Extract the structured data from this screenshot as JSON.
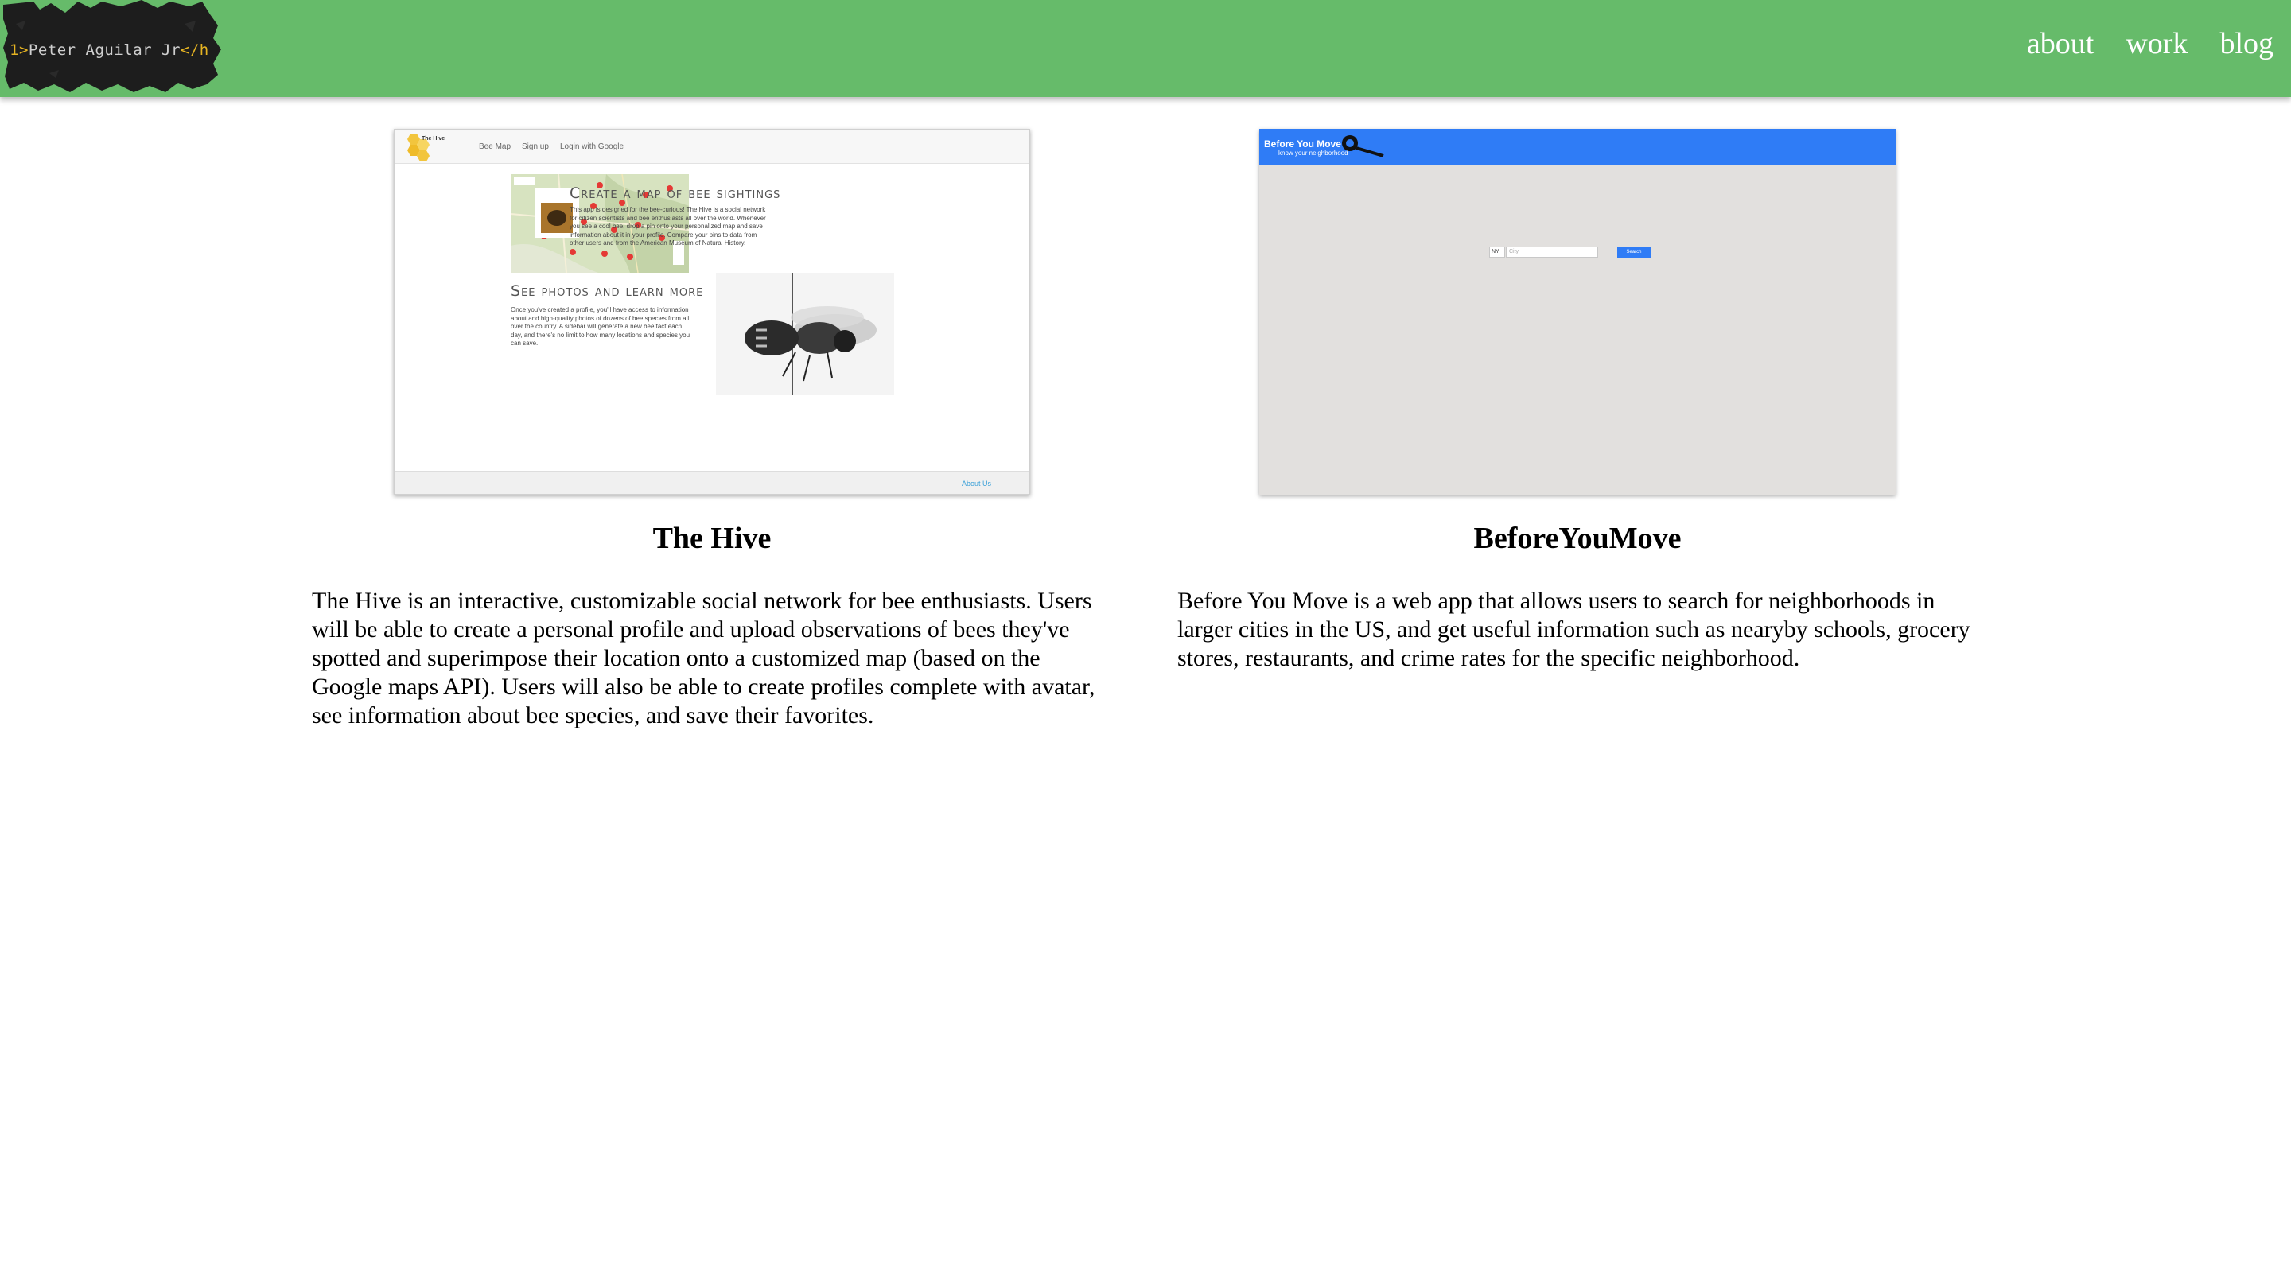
{
  "header": {
    "logo_text_open": "1>",
    "logo_text_name": "Peter Aguilar Jr",
    "logo_text_close": "</h",
    "nav": [
      {
        "label": "about"
      },
      {
        "label": "work"
      },
      {
        "label": "blog"
      }
    ]
  },
  "projects": [
    {
      "title": "The Hive",
      "description": "The Hive is an interactive, customizable social network for bee enthusiasts. Users will be able to create a personal profile and upload observations of bees they've spotted and superimpose their location onto a customized map (based on the Google maps API). Users will also be able to create profiles complete with avatar, see information about bee species, and save their favorites.",
      "screenshot": {
        "brand": "The Hive",
        "nav": [
          "Bee Map",
          "Sign up",
          "Login with Google"
        ],
        "heading1": "Create a map of bee sightings",
        "para1": "This app is designed for the bee-curious! The Hive is a social network for citizen scientists and bee enthusiasts all over the world. Whenever you see a cool bee, drop a pin onto your personalized map and save information about it in your profile. Compare your pins to data from other users and from the American Museum of Natural History.",
        "heading2": "See photos and learn more",
        "para2": "Once you've created a profile, you'll have access to information about and high-quality photos of dozens of bee species from all over the country. A sidebar will generate a new bee fact each day, and there's no limit to how many locations and species you can save.",
        "footer_link": "About Us"
      }
    },
    {
      "title": "BeforeYouMove",
      "description": "Before You Move is a web app that allows users to search for neighborhoods in larger cities in the US, and get useful information such as nearyby schools, grocery stores, restaurants, and crime rates for the specific neighborhood.",
      "screenshot": {
        "brand": "Before You Move",
        "tagline": "know your neighborhood",
        "state_value": "NY",
        "city_placeholder": "City",
        "search_label": "Search"
      }
    }
  ],
  "colors": {
    "header_bg": "#66bb6a",
    "nav_text": "#ffffff",
    "bym_bar": "#2f7cf6",
    "logo_tag": "#e6b422"
  }
}
